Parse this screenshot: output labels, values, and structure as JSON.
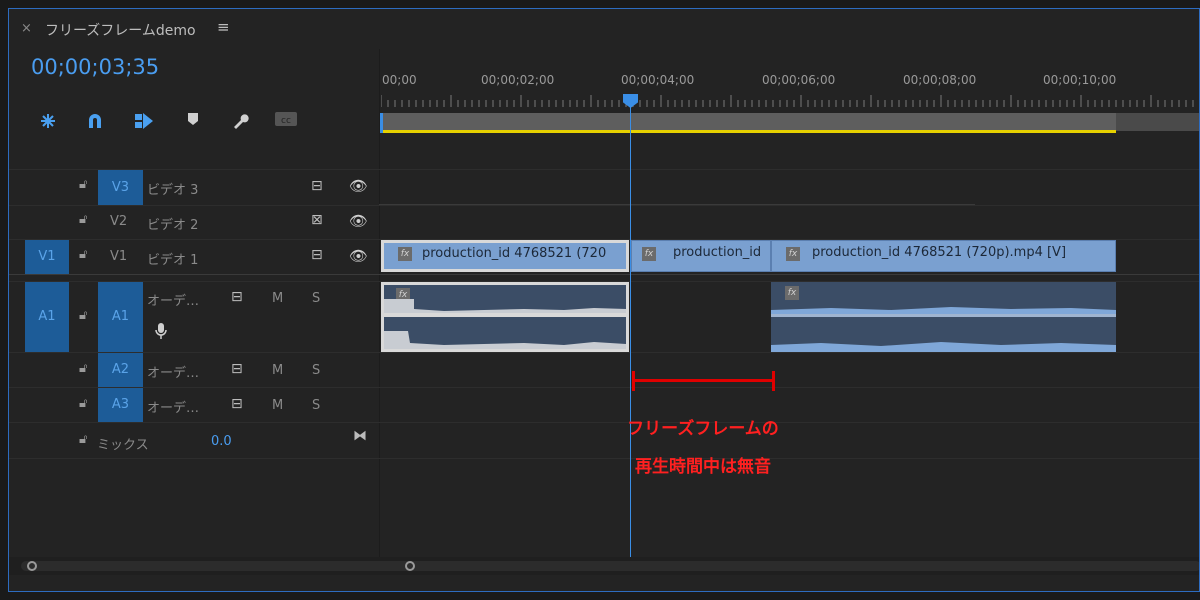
{
  "tab": {
    "close": "×",
    "title": "フリーズフレームdemo",
    "menu": "≡"
  },
  "timecode": "00;00;03;35",
  "tools": [
    "snap-icon",
    "magnet-icon",
    "linked-selection-icon",
    "marker-icon",
    "wrench-icon",
    "cc-icon"
  ],
  "ruler": [
    "00;00",
    "00;00;02;00",
    "00;00;04;00",
    "00;00;06;00",
    "00;00;08;00",
    "00;00;10;00"
  ],
  "tracks": {
    "v3": {
      "id": "V3",
      "name": "ビデオ 3"
    },
    "v2": {
      "id": "V2",
      "name": "ビデオ 2"
    },
    "v1": {
      "source": "V1",
      "id": "V1",
      "name": "ビデオ 1"
    },
    "a1": {
      "source": "A1",
      "id": "A1",
      "name": "オーデ…",
      "m": "M",
      "s": "S"
    },
    "a2": {
      "id": "A2",
      "name": "オーデ…",
      "m": "M",
      "s": "S"
    },
    "a3": {
      "id": "A3",
      "name": "オーデ…",
      "m": "M",
      "s": "S"
    },
    "mix": {
      "name": "ミックス",
      "value": "0.0"
    }
  },
  "clips": {
    "clip1": "production_id 4768521 (720",
    "clip2": "production_id",
    "clip3": "production_id 4768521 (720p).mp4 [V]",
    "fx": "fx"
  },
  "annotation": {
    "line1": "フリーズフレームの",
    "line2": "再生時間中は無音",
    "color": "#ff2020"
  },
  "colors": {
    "accent": "#3a8ee6",
    "workarea": "#e6d100",
    "clip_video": "#7aa0d0",
    "clip_audio": "#3b4d66"
  }
}
